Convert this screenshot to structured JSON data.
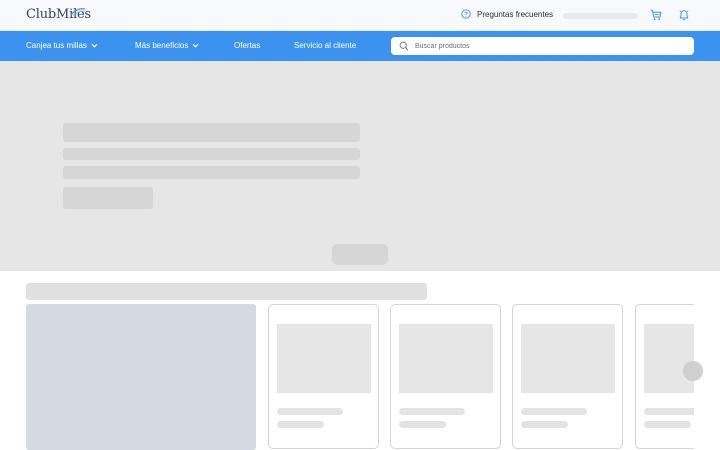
{
  "header": {
    "logo_text": "ClubMiles",
    "faq_label": "Preguntas frecuentes",
    "icons": {
      "faq": "help-circle-icon",
      "cart": "shopping-cart-icon",
      "notifications": "bell-icon"
    }
  },
  "nav": {
    "items": [
      {
        "label": "Canjea tus millas",
        "has_dropdown": true
      },
      {
        "label": "Más beneficios",
        "has_dropdown": true
      },
      {
        "label": "Ofertas",
        "has_dropdown": false
      },
      {
        "label": "Servicio al cliente",
        "has_dropdown": false
      }
    ],
    "search": {
      "placeholder": "Buscar productos",
      "value": ""
    }
  },
  "colors": {
    "nav_background": "#3c92ef",
    "header_background": "#f7f9fc",
    "skeleton": "#d6d6d6",
    "hero_background": "#e6e6e6"
  },
  "state": "loading"
}
